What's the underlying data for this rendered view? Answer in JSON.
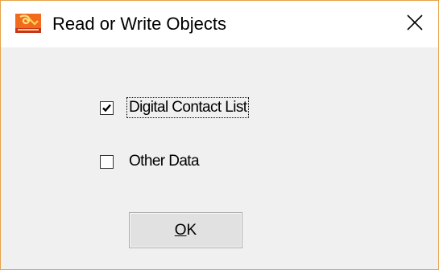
{
  "window": {
    "title": "Read or Write Objects",
    "icon": "app-logo-icon",
    "close_icon": "close-icon",
    "border_color": "#e8a24a"
  },
  "options": [
    {
      "label": "Digital Contact List",
      "checked": true,
      "focused": true
    },
    {
      "label": "Other Data",
      "checked": false,
      "focused": false
    }
  ],
  "ok_button": {
    "accel": "O",
    "rest": "K"
  }
}
